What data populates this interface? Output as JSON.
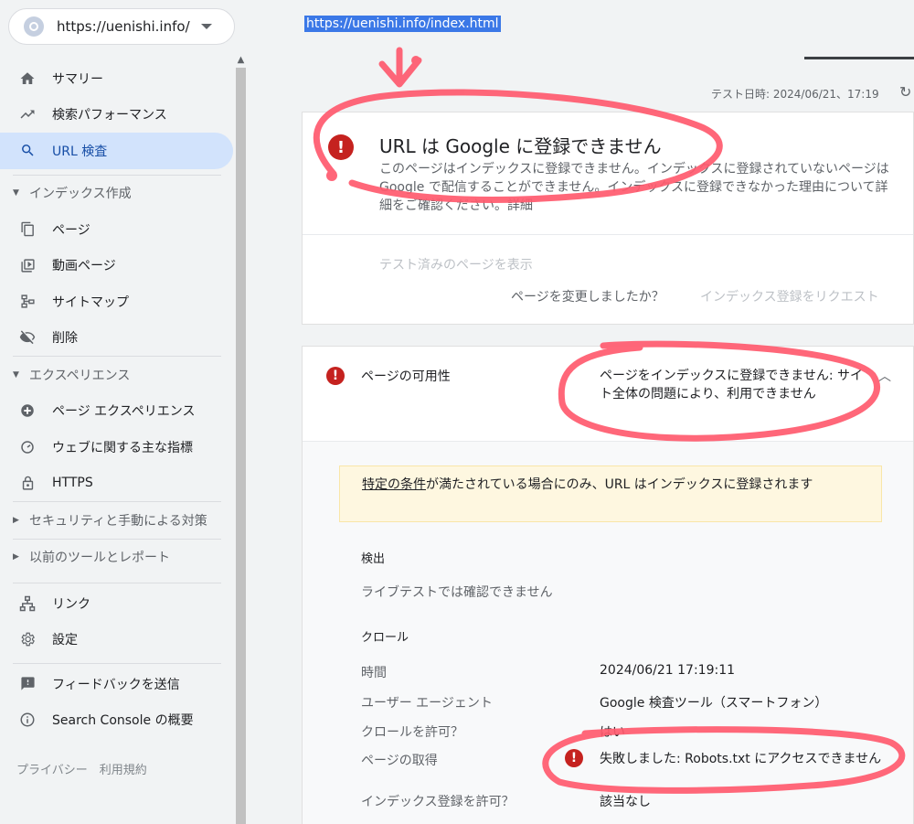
{
  "property": {
    "url": "https://uenishi.info/"
  },
  "sidebar": {
    "items": [
      {
        "label": "サマリー",
        "icon": "home-icon"
      },
      {
        "label": "検索パフォーマンス",
        "icon": "trending-icon"
      },
      {
        "label": "URL 検査",
        "icon": "search-icon"
      }
    ],
    "index_section": "インデックス作成",
    "index_items": [
      {
        "label": "ページ",
        "icon": "pages-icon"
      },
      {
        "label": "動画ページ",
        "icon": "video-icon"
      },
      {
        "label": "サイトマップ",
        "icon": "sitemap-icon"
      },
      {
        "label": "削除",
        "icon": "removal-icon"
      }
    ],
    "experience_section": "エクスペリエンス",
    "experience_items": [
      {
        "label": "ページ エクスペリエンス",
        "icon": "plus-circle-icon"
      },
      {
        "label": "ウェブに関する主な指標",
        "icon": "gauge-icon"
      },
      {
        "label": "HTTPS",
        "icon": "lock-icon"
      }
    ],
    "security_section": "セキュリティと手動による対策",
    "legacy_section": "以前のツールとレポート",
    "bottom_items": [
      {
        "label": "リンク",
        "icon": "links-icon"
      },
      {
        "label": "設定",
        "icon": "gear-icon"
      }
    ],
    "footer_items": [
      {
        "label": "フィードバックを送信",
        "icon": "feedback-icon"
      },
      {
        "label": "Search Console の概要",
        "icon": "info-icon"
      }
    ],
    "privacy": "プライバシー　利用規約"
  },
  "main": {
    "inspected_url": "https://uenishi.info/index.html",
    "test_date": "テスト日時: 2024/06/21、17:19",
    "status_title": "URL は Google に登録できません",
    "status_desc": "このページはインデックスに登録できません。インデックスに登録されていないページは Google で配信することができません。インデックスに登録できなかった理由について詳細をご確認ください。",
    "status_desc_link": "詳細",
    "view_tested": "テスト済みのページを表示",
    "changed_q": "ページを変更しましたか？",
    "request_index": "インデックス登録をリクエスト",
    "availability_label": "ページの可用性",
    "availability_value": "ページをインデックスに登録できません: サイト全体の問題により、利用できません",
    "notice_link": "特定の条件",
    "notice_text": "が満たされている場合にのみ、URL はインデックスに登録されます",
    "discovery_title": "検出",
    "discovery_value": "ライブテストでは確認できません",
    "crawl_title": "クロール",
    "rows": {
      "time_label": "時間",
      "time_value": "2024/06/21 17:19:11",
      "ua_label": "ユーザー エージェント",
      "ua_value": "Google 検査ツール（スマートフォン）",
      "crawl_allowed_label": "クロールを許可？",
      "crawl_allowed_value": "はい",
      "fetch_label": "ページの取得",
      "fetch_value": "失敗しました: Robots.txt にアクセスできません",
      "index_allowed_label": "インデックス登録を許可？",
      "index_allowed_value": "該当なし"
    }
  },
  "colors": {
    "accent": "#1a73e8",
    "error": "#c5221f",
    "annotation": "#ff5a6e",
    "active_bg": "#d2e3fc"
  }
}
